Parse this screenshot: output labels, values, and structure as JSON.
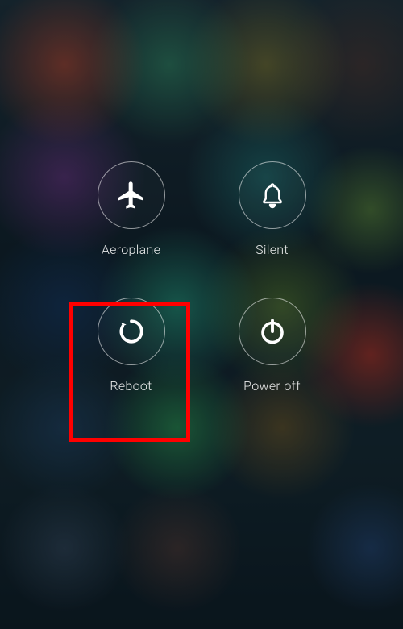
{
  "options": {
    "aeroplane": {
      "label": "Aeroplane",
      "icon": "airplane-icon"
    },
    "silent": {
      "label": "Silent",
      "icon": "bell-icon"
    },
    "reboot": {
      "label": "Reboot",
      "icon": "reboot-icon"
    },
    "poweroff": {
      "label": "Power off",
      "icon": "power-icon"
    }
  },
  "highlighted": "reboot",
  "colors": {
    "icon_stroke": "#ffffff",
    "label": "rgba(255,255,255,0.9)",
    "circle_border": "rgba(255,255,255,0.55)",
    "highlight": "#ff0000"
  }
}
